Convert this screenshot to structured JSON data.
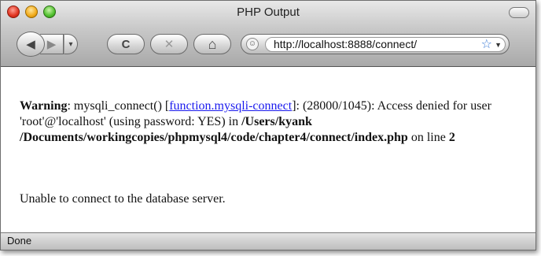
{
  "window": {
    "title": "PHP Output"
  },
  "toolbar": {
    "back_icon": "◀",
    "forward_icon": "▶",
    "history_icon": "▾",
    "reload_icon": "C",
    "stop_icon": "✕",
    "home_icon": "⌂"
  },
  "address_bar": {
    "url": "http://localhost:8888/connect/",
    "bookmark_icon": "☆",
    "dropdown_icon": "▼",
    "site_icon": "☺"
  },
  "page": {
    "warning_label": "Warning",
    "warning_sep": ": ",
    "warning_func": "mysqli_connect() [",
    "warning_link": "function.mysqli-connect",
    "warning_mid": "]: (28000/1045): Access denied for user 'root'@'localhost' (using password: YES) in ",
    "warning_path": "/Users/kyank /Documents/workingcopies/phpmysql4/code/chapter4/connect/index.php",
    "warning_on_line": " on line ",
    "warning_line_number": "2",
    "message": "Unable to connect to the database server."
  },
  "status": {
    "text": "Done"
  },
  "colors": {
    "link": "#1a1aee",
    "bookmark_star": "#3a7ad6"
  }
}
